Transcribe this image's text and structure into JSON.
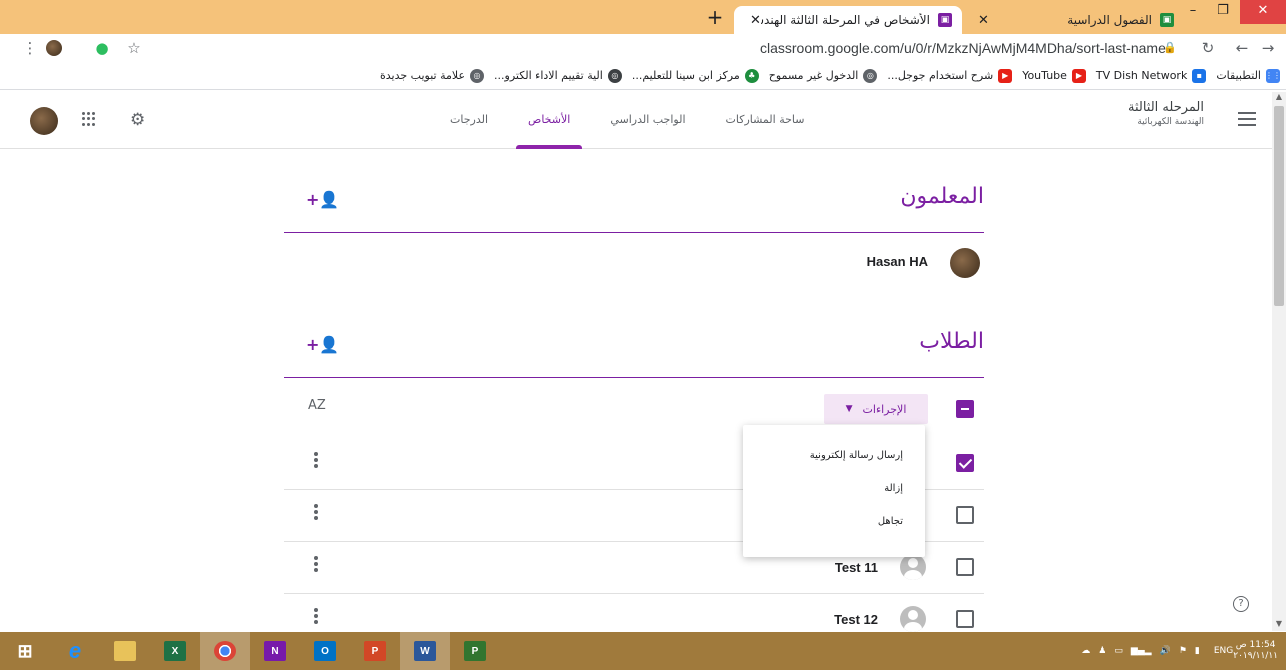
{
  "browser": {
    "tabs": [
      {
        "title": "الفصول الدراسية",
        "active": false
      },
      {
        "title": "الأشخاص في المرحلة الثالثة الهندسـ",
        "active": true
      }
    ],
    "new_tab": "+",
    "url": "classroom.google.com/u/0/r/MzkzNjAwMjM4MDha/sort-last-name",
    "bookmarks": [
      {
        "label": "التطبيقات",
        "icon": "apps-grid-icon",
        "color": "#4285f4"
      },
      {
        "label": "TV Dish Network",
        "icon": "tv-icon",
        "color": "#1a73e8"
      },
      {
        "label": "YouTube",
        "icon": "youtube-icon",
        "color": "#e62117"
      },
      {
        "label": "شرح استخدام جوجل...",
        "icon": "youtube-icon",
        "color": "#e62117"
      },
      {
        "label": "الدخول غير مسموح",
        "icon": "globe-icon",
        "color": "#5f6368"
      },
      {
        "label": "مركز ابن سينا للتعليم...",
        "icon": "plant-icon",
        "color": "#1e8e3e"
      },
      {
        "label": "الية تقييم الاداء الكترو...",
        "icon": "globe-icon",
        "color": "#3c4043"
      },
      {
        "label": "علامة تبويب جديدة",
        "icon": "globe-icon",
        "color": "#5f6368"
      }
    ]
  },
  "classroom": {
    "class_name": "المرحله الثالثة",
    "class_subtitle": "الهندسة الكهربائية",
    "nav": [
      "ساحة المشاركات",
      "الواجب الدراسي",
      "الأشخاص",
      "الدرجات"
    ],
    "active_nav": "الأشخاص",
    "teachers": {
      "title": "المعلمون",
      "people": [
        {
          "name": "Hasan HA"
        }
      ]
    },
    "students": {
      "title": "الطلاب",
      "actions_label": "الإجراءات",
      "sort_label": "AZ",
      "rows": [
        {
          "name": "",
          "checked": true
        },
        {
          "name": "",
          "checked": false
        },
        {
          "name": "Test 11",
          "checked": false
        },
        {
          "name": "Test 12",
          "checked": false
        }
      ]
    },
    "actions_menu": [
      "إرسال رسالة إلكترونية",
      "إزالة",
      "تجاهل"
    ]
  },
  "taskbar": {
    "apps": [
      "windows",
      "ie",
      "explorer",
      "excel",
      "chrome",
      "onenote",
      "outlook",
      "powerpoint",
      "word",
      "project"
    ],
    "lang": "ENG",
    "time": "11:54 ص",
    "date": "٢٠١٩/١١/١١"
  }
}
